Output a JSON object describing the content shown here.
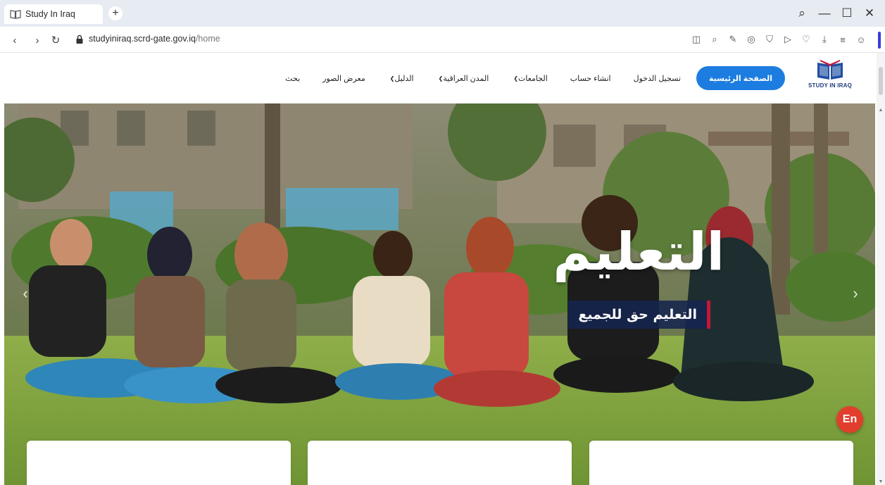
{
  "browser": {
    "tab_title": "Study In Iraq",
    "new_tab_label": "+",
    "url_host": "studyiniraq.scrd-gate.gov.iq",
    "url_path": "/home",
    "accent_color": "#3b3bd8"
  },
  "site": {
    "logo_text": "STUDY IN IRAQ",
    "nav": [
      {
        "label": "الصفحة الرئيسية",
        "active": true,
        "dropdown": false
      },
      {
        "label": "تسجيل الدخول",
        "active": false,
        "dropdown": false
      },
      {
        "label": "انشاء حساب",
        "active": false,
        "dropdown": false
      },
      {
        "label": "الجامعات",
        "active": false,
        "dropdown": true
      },
      {
        "label": "المدن العراقية",
        "active": false,
        "dropdown": true
      },
      {
        "label": "الدليل",
        "active": false,
        "dropdown": true
      },
      {
        "label": "معرض الصور",
        "active": false,
        "dropdown": false
      },
      {
        "label": "بحث",
        "active": false,
        "dropdown": false
      }
    ],
    "brand_color": "#1c7ce0"
  },
  "hero": {
    "title": "التعليم",
    "subtitle": "التعليم حق للجميع",
    "language_button": "En",
    "subtitle_accent": "#c4163b",
    "lang_color": "#e23e2d"
  }
}
